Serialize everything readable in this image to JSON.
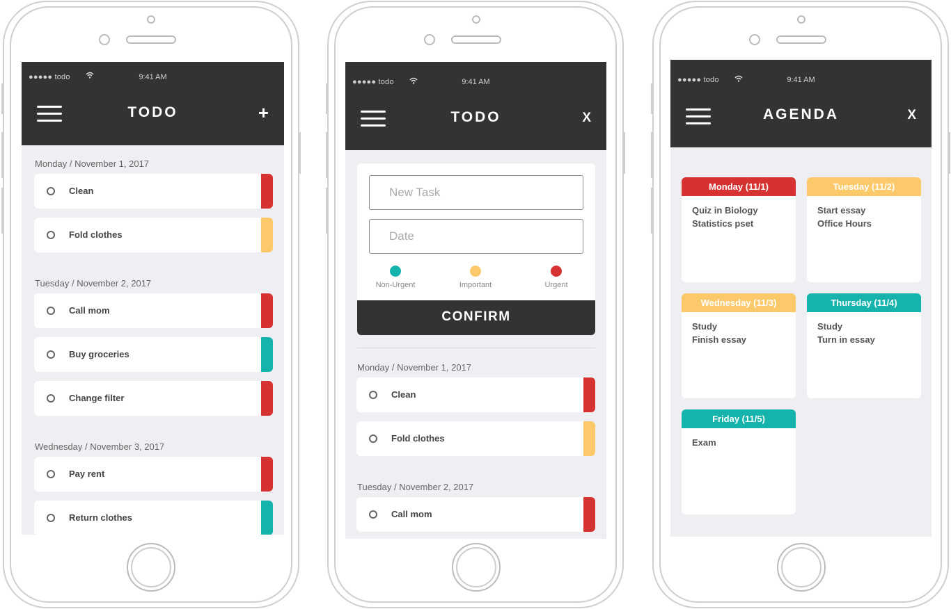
{
  "colors": {
    "urgent": "#d63232",
    "important": "#fcc96a",
    "non_urgent": "#16b3ad",
    "navbar": "#333333",
    "screen_bg": "#efeff3"
  },
  "phone1": {
    "status": {
      "carrier": "●●●●● todo",
      "time": "9:41 AM"
    },
    "title": "TODO",
    "action": "+",
    "groups": [
      {
        "date": "Monday / November 1, 2017",
        "tasks": [
          {
            "label": "Clean",
            "priority": "urgent"
          },
          {
            "label": "Fold clothes",
            "priority": "important"
          }
        ]
      },
      {
        "date": "Tuesday / November 2, 2017",
        "tasks": [
          {
            "label": "Call mom",
            "priority": "urgent"
          },
          {
            "label": "Buy groceries",
            "priority": "non_urgent"
          },
          {
            "label": "Change filter",
            "priority": "urgent"
          }
        ]
      },
      {
        "date": "Wednesday / November 3, 2017",
        "tasks": [
          {
            "label": "Pay rent",
            "priority": "urgent"
          },
          {
            "label": "Return clothes",
            "priority": "non_urgent"
          }
        ]
      }
    ]
  },
  "phone2": {
    "status": {
      "carrier": "●●●●● todo",
      "time": "9:41 AM"
    },
    "title": "TODO",
    "action": "X",
    "form": {
      "task_placeholder": "New Task",
      "date_placeholder": "Date",
      "priorities": [
        {
          "label": "Non-Urgent",
          "key": "non_urgent"
        },
        {
          "label": "Important",
          "key": "important"
        },
        {
          "label": "Urgent",
          "key": "urgent"
        }
      ],
      "confirm_label": "CONFIRM"
    },
    "groups": [
      {
        "date": "Monday / November 1, 2017",
        "tasks": [
          {
            "label": "Clean",
            "priority": "urgent"
          },
          {
            "label": "Fold clothes",
            "priority": "important"
          }
        ]
      },
      {
        "date": "Tuesday / November 2, 2017",
        "tasks": [
          {
            "label": "Call mom",
            "priority": "urgent"
          }
        ]
      }
    ]
  },
  "phone3": {
    "status": {
      "carrier": "●●●●● todo",
      "time": "9:41 AM"
    },
    "title": "AGENDA",
    "action": "X",
    "days": [
      {
        "title": "Monday (11/1)",
        "priority": "urgent",
        "items": [
          "Quiz in Biology",
          "Statistics pset"
        ]
      },
      {
        "title": "Tuesday (11/2)",
        "priority": "important",
        "items": [
          "Start essay",
          "Office Hours"
        ]
      },
      {
        "title": "Wednesday (11/3)",
        "priority": "important",
        "items": [
          "Study",
          "Finish essay"
        ]
      },
      {
        "title": "Thursday (11/4)",
        "priority": "non_urgent",
        "items": [
          "Study",
          "Turn in essay"
        ]
      },
      {
        "title": "Friday (11/5)",
        "priority": "non_urgent",
        "items": [
          "Exam"
        ]
      }
    ]
  }
}
